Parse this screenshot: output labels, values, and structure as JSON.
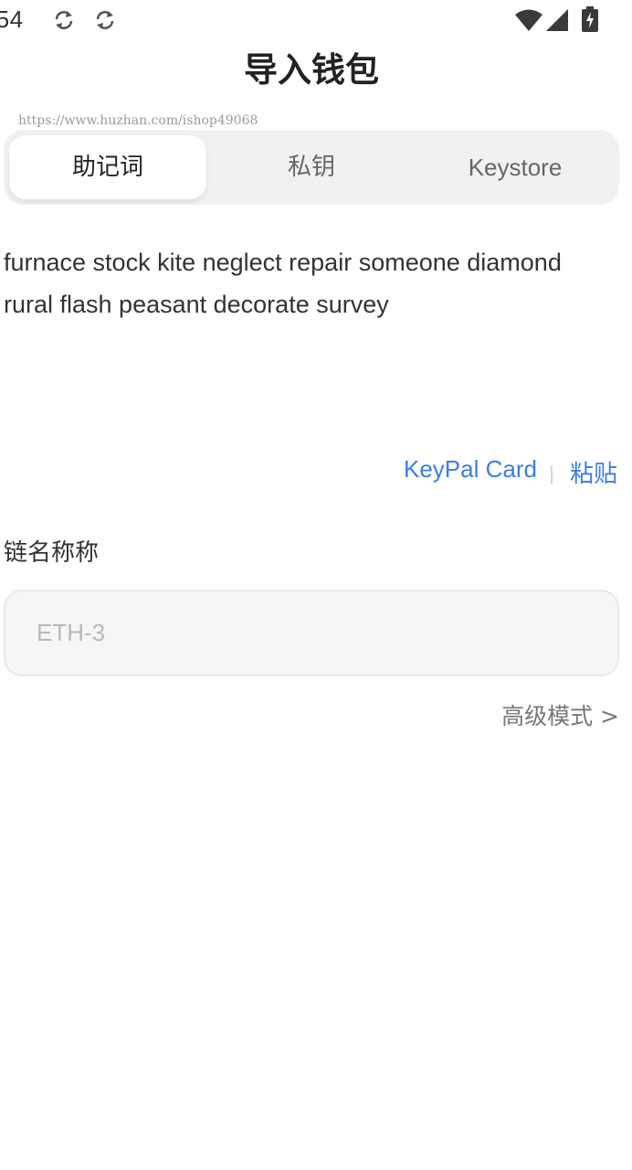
{
  "status_bar": {
    "time": ":54",
    "icons": [
      "sync-icon",
      "sync-icon",
      "wifi-icon",
      "signal-icon",
      "battery-charging-icon"
    ]
  },
  "header": {
    "title": "导入钱包"
  },
  "watermark": "https://www.huzhan.com/ishop49068",
  "tabs": [
    {
      "label": "助记词",
      "active": true
    },
    {
      "label": "私钥",
      "active": false
    },
    {
      "label": "Keystore",
      "active": false
    }
  ],
  "mnemonic": {
    "value": "furnace stock kite neglect repair someone diamond rural flash peasant decorate survey"
  },
  "actions": {
    "keypal_label": "KeyPal Card",
    "paste_label": "粘贴"
  },
  "chain": {
    "label": "链名称称",
    "placeholder": "ETH-3"
  },
  "advanced": {
    "label": "高级模式 >"
  },
  "colors": {
    "accent": "#3a7ee6",
    "tab_bg": "#f1f1f1",
    "input_bg": "#f6f6f6"
  }
}
